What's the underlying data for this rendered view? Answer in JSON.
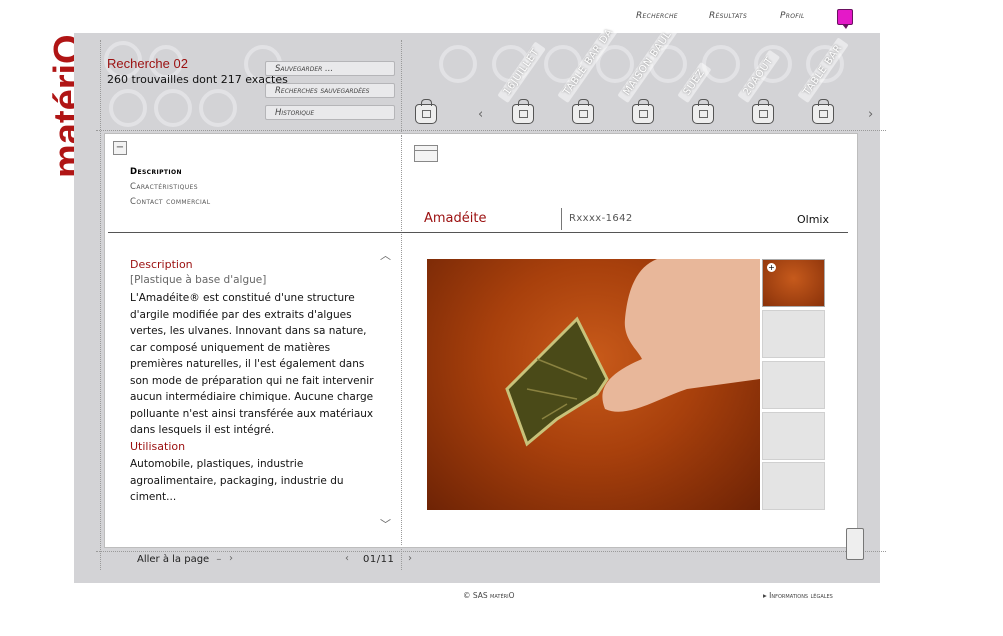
{
  "brand": {
    "logo_text": "matériO",
    "accent": "#b01515"
  },
  "topnav": {
    "search": "Recherche",
    "results": "Résultats",
    "profile": "Profil"
  },
  "search": {
    "title": "Recherche 02",
    "summary": "260 trouvailles dont 217 exactes",
    "save_label": "Sauvegarder ...",
    "saved_label": "Recherches sauvegardées",
    "history_label": "Historique"
  },
  "baskets": [
    {
      "label": ""
    },
    {
      "label": "16JUILLET"
    },
    {
      "label": "TABLE BAR DA"
    },
    {
      "label": "MAISON BAUL"
    },
    {
      "label": "SUEZ"
    },
    {
      "label": "20AOUT"
    },
    {
      "label": "TABLE BAR"
    }
  ],
  "sidebar": {
    "collapse_icon": "−",
    "links": [
      "Description",
      "Caractéristiques",
      "Contact commercial"
    ]
  },
  "material": {
    "name": "Amadéite",
    "reference": "Rxxxx-1642",
    "brand": "Olmix"
  },
  "description": {
    "title": "Description",
    "subtitle": "[Plastique à base d'algue]",
    "body": "L'Amadéite® est constitué d'une structure d'argile modifiée par des extraits d'algues vertes, les ulvanes. Innovant dans sa nature, car composé uniquement de matières premières naturelles, il l'est également dans son mode de préparation qui ne fait intervenir aucun intermédiaire chimique. Aucune charge polluante n'est ainsi transférée aux matériaux dans lesquels il est intégré.",
    "use_title": "Utilisation",
    "use_body": "Automobile, plastiques, industrie agroalimentaire, packaging, industrie du ciment..."
  },
  "pager": {
    "goto_label": "Aller à la page",
    "goto_sep": "–",
    "count": "01/11"
  },
  "footer": {
    "copyright": "© SAS matériO",
    "legal": "▸ Informations légales"
  }
}
